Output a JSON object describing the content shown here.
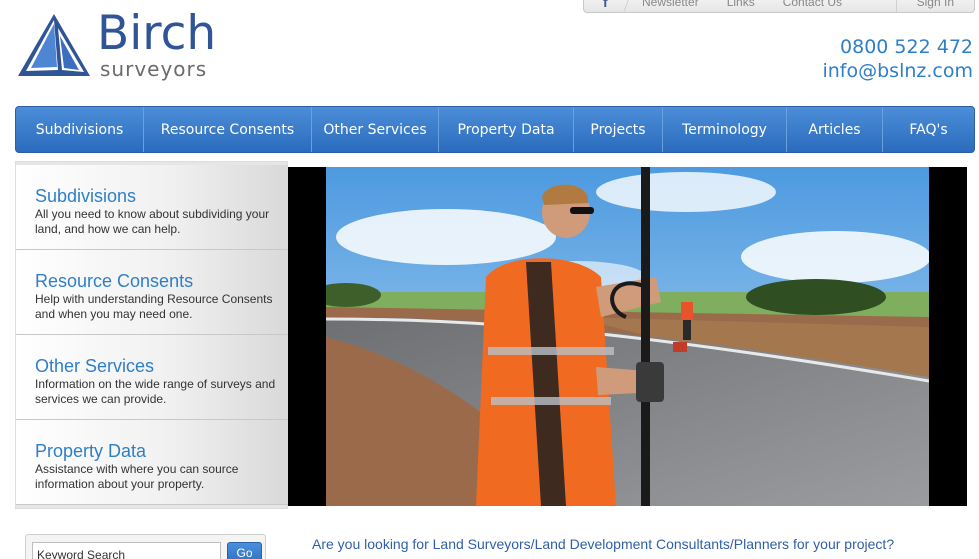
{
  "topbar": {
    "facebook_icon": "facebook-icon",
    "links": [
      "Newsletter",
      "Links",
      "Contact Us"
    ],
    "signin": "Sign In"
  },
  "logo": {
    "word": "Birch",
    "sub": "surveyors"
  },
  "contact": {
    "phone": "0800 522 472",
    "email": "info@bslnz.com"
  },
  "nav": {
    "items": [
      "Subdivisions",
      "Resource Consents",
      "Other Services",
      "Property Data",
      "Projects",
      "Terminology",
      "Articles",
      "FAQ's"
    ]
  },
  "side": {
    "blocks": [
      {
        "title": "Subdivisions",
        "desc": "All you need to know about subdividing your land, and how we can help."
      },
      {
        "title": "Resource Consents",
        "desc": "Help with understanding Resource Consents and when you may need one."
      },
      {
        "title": "Other Services",
        "desc": "Information on the wide range of surveys and services we can provide."
      },
      {
        "title": "Property Data",
        "desc": "Assistance with where you can source information about your property."
      }
    ]
  },
  "search": {
    "placeholder": "Keyword Search",
    "button": "Go"
  },
  "headline": "Are you looking for Land Surveyors/Land Development Consultants/Planners for your project?",
  "colors": {
    "brand": "#2f5597",
    "accent": "#2f7fc8",
    "nav": "#3a7ccc"
  }
}
